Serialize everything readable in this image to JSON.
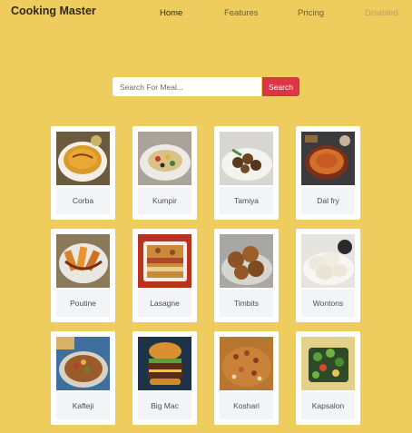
{
  "brand": "Cooking Master",
  "nav": {
    "home": "Home",
    "features": "Features",
    "pricing": "Pricing",
    "disabled": "Disabled"
  },
  "search": {
    "placeholder": "Search For Meal...",
    "button_label": "Search"
  },
  "meals": [
    {
      "name": "Corba"
    },
    {
      "name": "Kumpir"
    },
    {
      "name": "Tamiya"
    },
    {
      "name": "Dal fry"
    },
    {
      "name": "Poutine"
    },
    {
      "name": "Lasagne"
    },
    {
      "name": "Timbits"
    },
    {
      "name": "Wontons"
    },
    {
      "name": "Kafteji"
    },
    {
      "name": "Big Mac"
    },
    {
      "name": "Koshari"
    },
    {
      "name": "Kapsalon"
    }
  ],
  "colors": {
    "page_background": "#eecd5e",
    "search_button": "#dc3545",
    "card_background": "#ffffff",
    "caption_background": "#f2f4f8"
  }
}
